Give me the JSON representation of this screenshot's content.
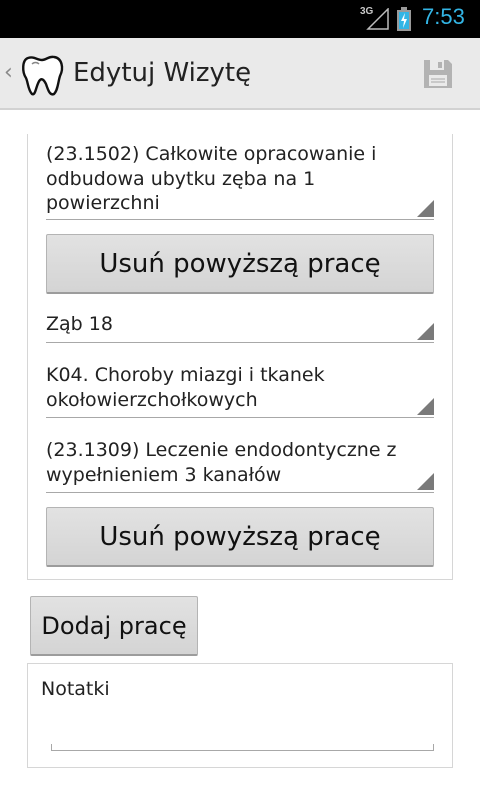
{
  "status_bar": {
    "network": "3G",
    "time": "7:53",
    "accent_color": "#33b5e5"
  },
  "action_bar": {
    "up_icon": "chevron-left-icon",
    "logo_icon": "tooth-icon",
    "title": "Edytuj Wizytę",
    "save_icon": "floppy-disk-icon"
  },
  "works": [
    {
      "procedure": "(23.1502) Całkowite opracowanie i odbudowa ubytku zęba na 1 powierzchni",
      "remove_label": "Usuń powyższą pracę"
    },
    {
      "tooth": "Ząb 18",
      "diagnosis": "K04. Choroby miazgi i tkanek okołowierzchołkowych",
      "procedure": "(23.1309) Leczenie endodontyczne z wypełnieniem 3 kanałów",
      "remove_label": "Usuń powyższą pracę"
    }
  ],
  "add_work_label": "Dodaj pracę",
  "notes": {
    "placeholder": "Notatki",
    "value": ""
  }
}
